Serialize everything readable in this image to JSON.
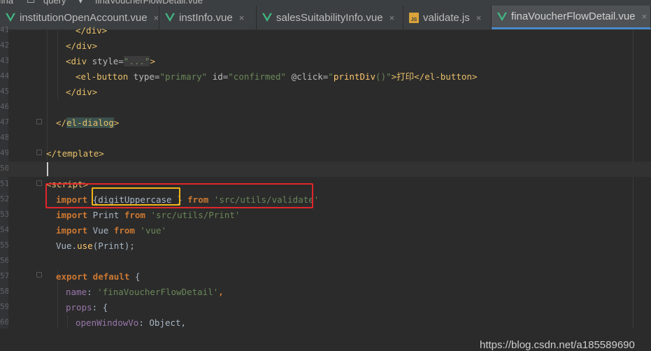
{
  "breadcrumb": [
    "fina",
    "query",
    "finaVoucherFlowDetail.vue"
  ],
  "tabs": [
    {
      "label": "institutionOpenAccount.vue",
      "icon": "vue-icon"
    },
    {
      "label": "instInfo.vue",
      "icon": "vue-icon"
    },
    {
      "label": "salesSuitabilityInfo.vue",
      "icon": "vue-icon"
    },
    {
      "label": "validate.js",
      "icon": "js-icon",
      "icon_text": "JS"
    },
    {
      "label": "finaVoucherFlowDetail.vue",
      "icon": "vue-icon",
      "active": true
    }
  ],
  "close_glyph": "×",
  "code": {
    "line_numbers": [
      "41",
      "42",
      "43",
      "44",
      "45",
      "46",
      "47",
      "48",
      "49",
      "50",
      "51",
      "52",
      "53",
      "54",
      "55",
      "56",
      "57",
      "58",
      "59",
      "60"
    ],
    "lines": {
      "l41": "</div>",
      "l42": "</div>",
      "l43": [
        "<div ",
        "style=",
        "\"...\"",
        ">"
      ],
      "l44": [
        "<el-button ",
        "type=",
        "\"primary\"",
        " id=",
        "\"confirmed\"",
        " @click=",
        "\"",
        "printDiv",
        "()\"",
        ">打印</",
        "el-button",
        ">"
      ],
      "l47": [
        "</",
        "el-dialog",
        ">"
      ],
      "l49": "</template>",
      "l51": "<script>",
      "l52": [
        "import",
        " {digitUppercase }",
        " from",
        " 'src/utils/validate'"
      ],
      "l53": [
        "import",
        " Print ",
        "from",
        " 'src/utils/Print'"
      ],
      "l54": [
        "import",
        " Vue ",
        "from",
        " 'vue'"
      ],
      "l55": [
        "Vue.",
        "use",
        "(Print);"
      ],
      "l57": [
        "export default",
        " {"
      ],
      "l58": [
        "name",
        ": ",
        "'finaVoucherFlowDetail'",
        ","
      ],
      "l59": [
        "props",
        ": {"
      ],
      "l60": [
        "openWindowVo",
        ": Object,"
      ]
    }
  },
  "watermark": "https://blog.csdn.net/a185589690",
  "colors": {
    "highlight_red": "#e0262a",
    "highlight_yellow": "#f2b417",
    "active_tab_underline": "#4a88c7"
  }
}
